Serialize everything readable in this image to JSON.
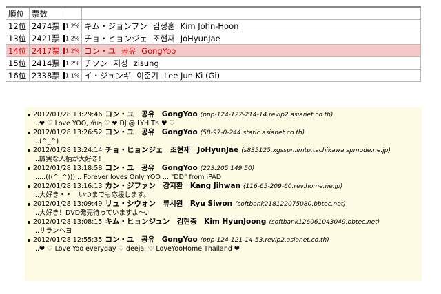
{
  "ranking": {
    "headers": [
      "順位",
      "票数"
    ],
    "rows": [
      {
        "rank": "12位",
        "votes": "2474票",
        "pct": "1.2%",
        "name_ja": "キム・ジョンフン",
        "name_ko": "김정훈",
        "name_en": "Kim John-Hoon",
        "highlight": false
      },
      {
        "rank": "13位",
        "votes": "2421票",
        "pct": "1.2%",
        "name_ja": "チョ・ヒョンジェ",
        "name_ko": "조현재",
        "name_en": "JoHyunJae",
        "highlight": false
      },
      {
        "rank": "14位",
        "votes": "2417票",
        "pct": "1.2%",
        "name_ja": "コン・ユ",
        "name_ko": "공유",
        "name_en": "GongYoo",
        "highlight": true
      },
      {
        "rank": "15位",
        "votes": "2414票",
        "pct": "1.2%",
        "name_ja": "チソン",
        "name_ko": "지성",
        "name_en": "zisung",
        "highlight": false
      },
      {
        "rank": "16位",
        "votes": "2338票",
        "pct": "1.1%",
        "name_ja": "イ・ジュンギ",
        "name_ko": "이준기",
        "name_en": "Lee Jun Ki (Gi)",
        "highlight": false
      }
    ]
  },
  "comments": [
    {
      "date": "2012/01/28 13:29:46",
      "name": "コン・ユ　공유　GongYoo",
      "host": "(ppp-124-122-214-14.revip2.asianet.co.th)",
      "message": "...❤ ♡ Love YOO, จ๊บๆ ♡ ❤ DJ @ LYH Th ♥ ♡"
    },
    {
      "date": "2012/01/28 13:26:52",
      "name": "コン・ユ　공유　GongYoo",
      "host": "(58-97-0-244.static.asianet.co.th)",
      "message": "...(^_^)"
    },
    {
      "date": "2012/01/28 13:24:14",
      "name": "チョ・ヒョンジェ　조현재　JoHyunJae",
      "host": "(s835125.xgsspn.imtp.tachikawa.spmode.ne.jp)",
      "message": "...誠実な人柄が大好き！"
    },
    {
      "date": "2012/01/28 13:18:58",
      "name": "コン・ユ　공유　GongYoo",
      "host": "(223.205.149.50)",
      "message": "......(((^_^)))... Forever loves Only YOO ... \"DD\" from iPAD"
    },
    {
      "date": "2012/01/28 13:16:13",
      "name": "カン・ジファン　강지환　Kang Jihwan",
      "host": "(116-65-209-60.rev.home.ne.jp)",
      "message": "...大好き・・　いつまでも応援します。"
    },
    {
      "date": "2012/01/28 13:09:49",
      "name": "リュ・シウォン　류시원　Ryu Siwon",
      "host": "(softbank218122075080.bbtec.net)",
      "message": "...大好き！DVD発売待っていますよ～♪"
    },
    {
      "date": "2012/01/28 13:08:15",
      "name": "キム・ヒョンジュン　김현중　Kim HyunJoong",
      "host": "(softbank126061043049.bbtec.net)",
      "message": "...サランヘヨ"
    },
    {
      "date": "2012/01/28 12:55:35",
      "name": "コン・ユ　공유　GongYoo",
      "host": "(ppp-124-121-14-53.revip2.asianet.co.th)",
      "message": "...❤ ♡ Love Yoo everyday ♡ deejai ♡ LoveYooHome Thailand ❤"
    }
  ],
  "colors": {
    "highlight_bg": "#f6c9c9",
    "highlight_text": "#cc0000",
    "comment_bg": "#fdfbe4"
  }
}
